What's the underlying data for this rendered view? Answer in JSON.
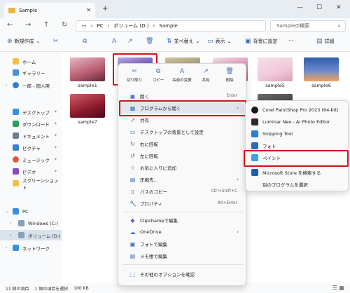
{
  "tab": {
    "title": "Sample",
    "close": "✕",
    "new": "+"
  },
  "window": {
    "min": "—",
    "max": "☐",
    "close": "✕"
  },
  "nav": {
    "back": "←",
    "forward": "→",
    "up": "↑",
    "refresh": "↻"
  },
  "address": {
    "pc": "PC",
    "volume": "ボリューム (D:)",
    "folder": "Sample",
    "sep": "›"
  },
  "search": {
    "placeholder": "Sampleの検索"
  },
  "toolbar": {
    "new_label": "新規作成",
    "sort_label": "並べ替え",
    "view_label": "表示",
    "background_label": "背景に設定",
    "more_label": "···",
    "details_label": "詳細"
  },
  "sidebar": {
    "items": [
      {
        "label": "ホーム"
      },
      {
        "label": "ギャラリー"
      },
      {
        "label": "一郎 - 個人用"
      },
      {
        "label": "デスクトップ"
      },
      {
        "label": "ダウンロード"
      },
      {
        "label": "ドキュメント"
      },
      {
        "label": "ピクチャ"
      },
      {
        "label": "ミュージック"
      },
      {
        "label": "ビデオ"
      },
      {
        "label": "スクリーンショット"
      },
      {
        "label": "PC"
      },
      {
        "label": "Windows (C:)"
      },
      {
        "label": "ボリューム (D:)"
      },
      {
        "label": "ネットワーク"
      }
    ]
  },
  "files": {
    "items": [
      {
        "label": "sample1",
        "color1": "#b85a6e",
        "color2": "#e6b8c4"
      },
      {
        "label": "",
        "color1": "#6a4fb5",
        "color2": "#b8a6e0"
      },
      {
        "label": "sample5",
        "color1": "#f0c8d8",
        "color2": "#f6e0ea"
      },
      {
        "label": "sample6",
        "color1": "#2f5ea8",
        "color2": "#f0a35a"
      },
      {
        "label": "sample7",
        "color1": "#8a1a2a",
        "color2": "#d45a6a"
      }
    ]
  },
  "status": {
    "count": "11 個の項目",
    "selected": "1 個の項目を選択",
    "size": "100 KB"
  },
  "context": {
    "quick": [
      {
        "label": "切り取り",
        "icon": "✂"
      },
      {
        "label": "コピー",
        "icon": "⧉"
      },
      {
        "label": "名前の変更",
        "icon": "A"
      },
      {
        "label": "共有",
        "icon": "↗"
      },
      {
        "label": "削除",
        "icon": "🗑"
      }
    ],
    "items": [
      {
        "label": "開く",
        "shortcut": "Enter",
        "icon": "▣"
      },
      {
        "label": "プログラムから開く",
        "shortcut": "",
        "icon": "▦"
      },
      {
        "label": "共有",
        "shortcut": "",
        "icon": "↗"
      },
      {
        "label": "デスクトップの背景として設定",
        "shortcut": "",
        "icon": "▭"
      },
      {
        "label": "右に回転",
        "shortcut": "",
        "icon": "↻"
      },
      {
        "label": "左に回転",
        "shortcut": "",
        "icon": "↺"
      },
      {
        "label": "お気に入りに追加",
        "shortcut": "",
        "icon": "☆"
      },
      {
        "label": "圧縮先...",
        "shortcut": "",
        "icon": "▤"
      },
      {
        "label": "パスのコピー",
        "shortcut": "Ctrl+Shift+C",
        "icon": "▯"
      },
      {
        "label": "プロパティ",
        "shortcut": "Alt+Enter",
        "icon": "🔧"
      },
      {
        "label": "Clipchampで編集",
        "shortcut": "",
        "icon": "◆"
      },
      {
        "label": "OneDrive",
        "shortcut": "",
        "icon": "☁"
      },
      {
        "label": "フォトで編集",
        "shortcut": "",
        "icon": "▣"
      },
      {
        "label": "メモ帳で編集",
        "shortcut": "",
        "icon": "▤"
      },
      {
        "label": "その他のオプションを確認",
        "shortcut": "",
        "icon": "⬚"
      }
    ]
  },
  "submenu": {
    "items": [
      {
        "label": "Corel PaintShop Pro 2023 (64-bit)",
        "color": "#1a1a1a"
      },
      {
        "label": "Luminar Neo - AI Photo Editor",
        "color": "#2b2b2b"
      },
      {
        "label": "Snipping Tool",
        "color": "#2a7fd4"
      },
      {
        "label": "フォト",
        "color": "#1f6fc0"
      },
      {
        "label": "ペイント",
        "color": "#3aa0e0"
      },
      {
        "label": "Microsoft Store を検索する",
        "color": "#1a5fb4"
      },
      {
        "label": "別のプログラムを選択",
        "color": ""
      }
    ]
  },
  "colors": {
    "highlight": "#d3131a",
    "accent": "#3a6fb5"
  }
}
